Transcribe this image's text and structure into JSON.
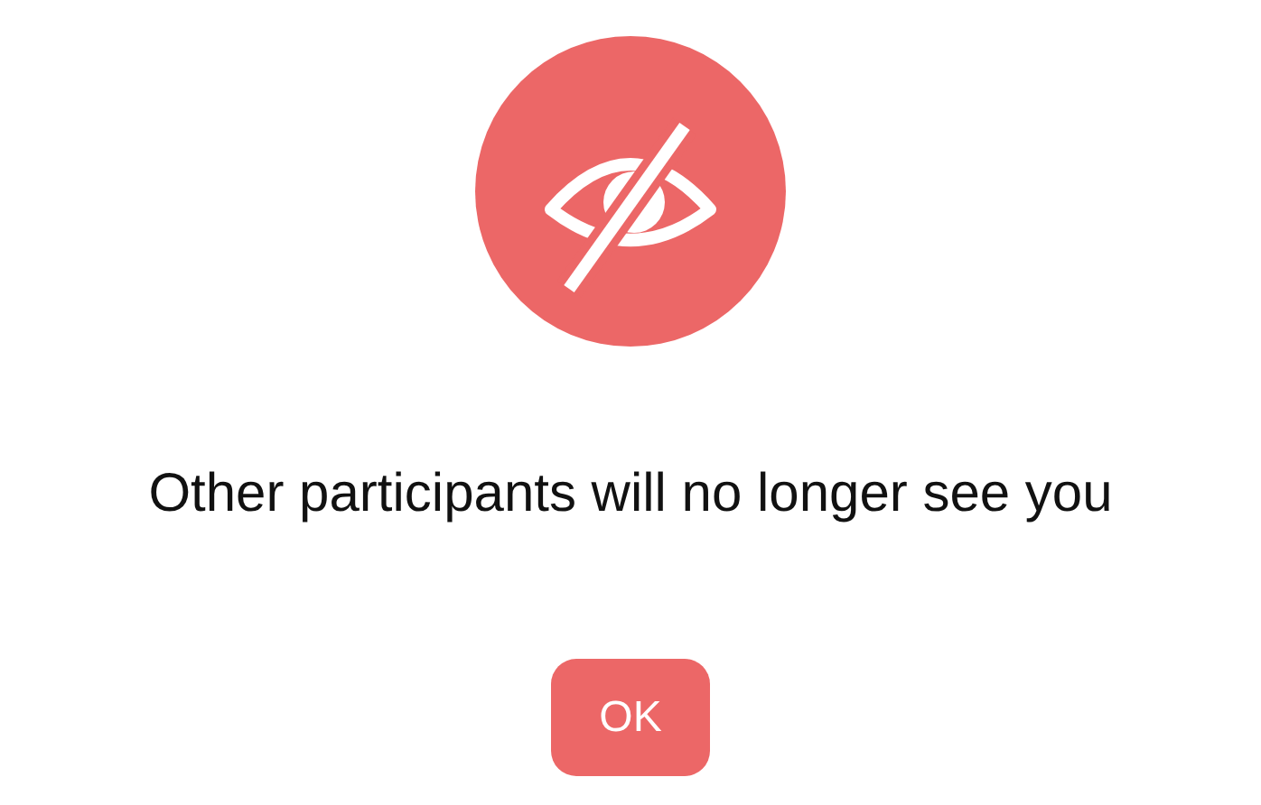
{
  "message": "Other participants will no longer see you",
  "buttons": [
    "OK"
  ]
}
